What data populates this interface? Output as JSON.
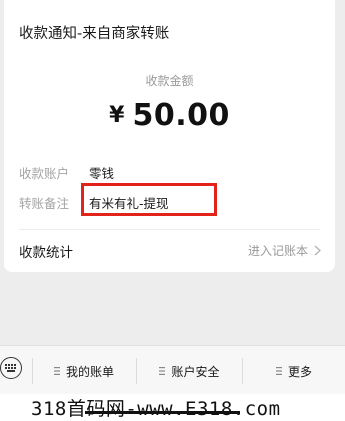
{
  "card": {
    "title": "收款通知-来自商家转账",
    "amount_label": "收款金额",
    "currency": "¥",
    "amount": "50.00",
    "details": [
      {
        "label": "收款账户",
        "value": "零钱"
      },
      {
        "label": "转账备注",
        "value": "有米有礼-提现"
      }
    ],
    "stats_label": "收款统计",
    "stats_link": "进入记账本"
  },
  "bottom_menu": {
    "items": [
      {
        "label": "我的账单"
      },
      {
        "label": "账户安全"
      },
      {
        "label": "更多"
      }
    ]
  },
  "watermark": {
    "text": "318首码网-www.E318.com"
  },
  "colors": {
    "highlight_border": "#e2231a",
    "background": "#ededed"
  },
  "icons": [
    "keyboard-icon",
    "menu-lines-icon",
    "chevron-right-icon"
  ]
}
